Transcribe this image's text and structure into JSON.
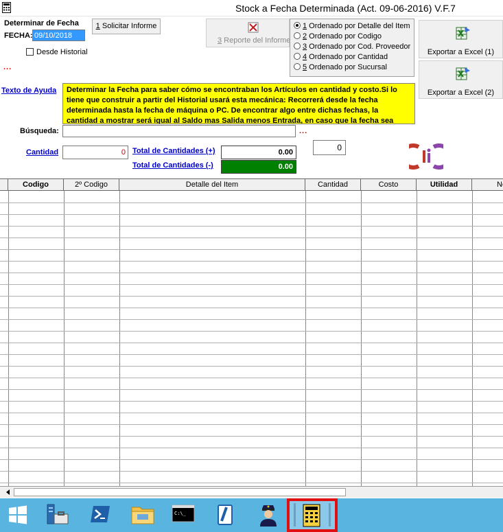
{
  "window": {
    "title": "Stock a Fecha Determinada (Act. 09-06-2016)  V.F.7"
  },
  "date_section": {
    "heading": "Determinar de Fecha",
    "fecha_label": "FECHA:",
    "fecha_value": "09/10/2018",
    "historial_label": "Desde Historial",
    "historial_checked": false,
    "dots": "..."
  },
  "buttons": {
    "solicitar_key": "1",
    "solicitar_label": " Solicitar Informe",
    "reporte_key": "3",
    "reporte_label": " Reporte del Informe",
    "excel1_label": "Exportar a Excel (1)",
    "excel2_label": "Exportar a Excel (2)"
  },
  "sort_options": [
    {
      "key": "1",
      "label": " Ordenado por Detalle del Item",
      "selected": true
    },
    {
      "key": "2",
      "label": " Ordenado por Codigo",
      "selected": false
    },
    {
      "key": "3",
      "label": " Ordenado por Cod. Proveedor",
      "selected": false
    },
    {
      "key": "4",
      "label": " Ordenado por Cantidad",
      "selected": false
    },
    {
      "key": "5",
      "label": " Ordenado por Sucursal",
      "selected": false
    }
  ],
  "help": {
    "link_label": "Texto de Ayuda",
    "text": "Determinar la Fecha para saber cómo se encontraban los Artículos en cantidad y costo.Si lo tiene que construir a partir del Historial usará esta mecánica: Recorrerá desde la fecha determinada hasta la fecha de máquina o PC. De encontrar algo entre dichas fechas, la cantidad a mostrar será igual al Saldo mas Salida menos Entrada,  en caso que la fecha sea"
  },
  "search": {
    "label": "Búsqueda:",
    "value": "",
    "dots": "..."
  },
  "totals": {
    "cantidad_label": "Cantidad",
    "cantidad_value": "0",
    "total_plus_label": "Total de Cantidades (+)",
    "total_plus_value": "0.00",
    "total_minus_label": "Total de Cantidades (-)",
    "total_minus_value": "0.00",
    "counter_value": "0"
  },
  "grid": {
    "columns": [
      "Codigo",
      "2º Codigo",
      "Detalle del Item",
      "Cantidad",
      "Costo",
      "Utilidad",
      "Ne"
    ]
  },
  "taskbar": {
    "items": [
      "windows-start-icon",
      "server-manager-icon",
      "powershell-icon",
      "file-explorer-icon",
      "command-prompt-icon",
      "notepad-icon",
      "police-user-icon",
      "stock-app-icon"
    ]
  },
  "colors": {
    "help_bg": "#ffff00",
    "green_total": "#008000",
    "link": "#0000cc",
    "date_highlight": "#3399ff",
    "taskbar": "#5ab4e0",
    "active_outline": "#e01010"
  }
}
